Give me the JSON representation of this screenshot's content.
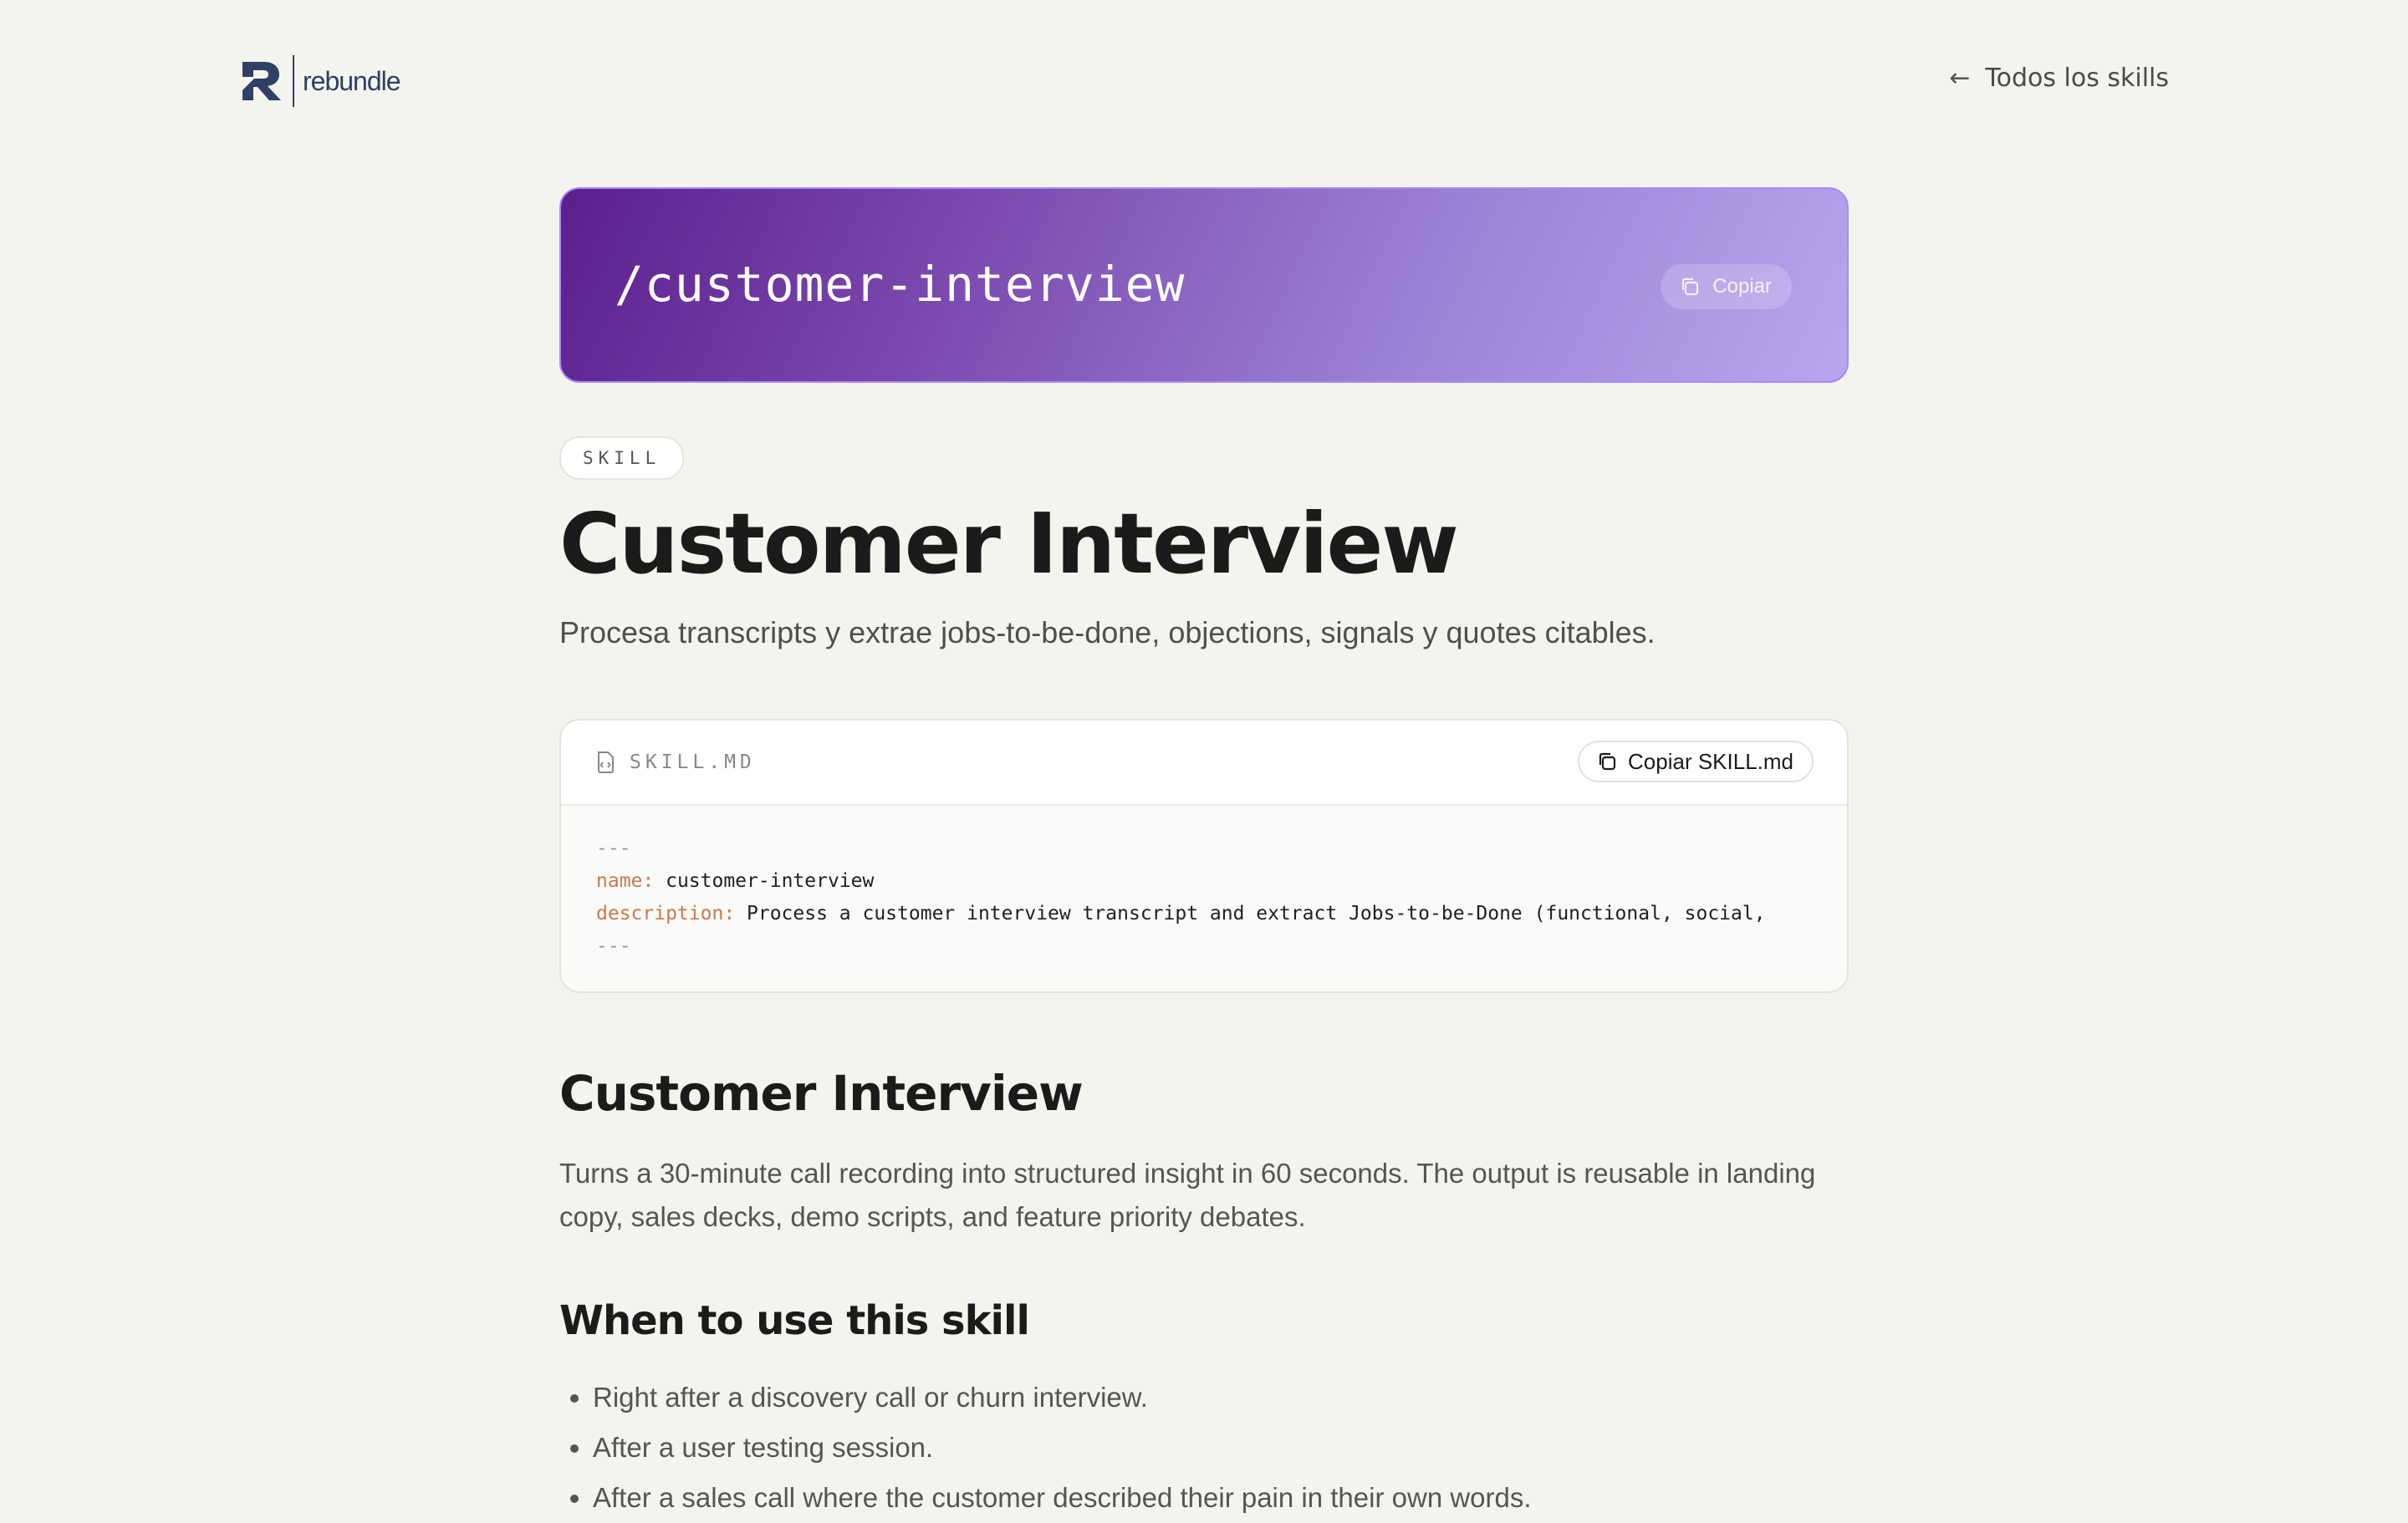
{
  "header": {
    "logo_text": "rebundle",
    "back_link_label": "Todos los skills"
  },
  "hero": {
    "command": "/customer-interview",
    "copy_label": "Copiar"
  },
  "skill": {
    "badge": "SKILL",
    "title": "Customer Interview",
    "subtitle": "Procesa transcripts y extrae jobs-to-be-done, objections, signals y quotes citables."
  },
  "skill_file": {
    "file_name": "SKILL.MD",
    "copy_label": "Copiar SKILL.md",
    "frontmatter_open": "---",
    "name_key": "name:",
    "name_value": " customer-interview",
    "description_key": "description:",
    "description_value": " Process a customer interview transcript and extract Jobs-to-be-Done (functional, social,",
    "frontmatter_close": "---"
  },
  "content": {
    "heading": "Customer Interview",
    "intro": "Turns a 30-minute call recording into structured insight in 60 seconds. The output is reusable in landing copy, sales decks, demo scripts, and feature priority debates.",
    "when_heading": "When to use this skill",
    "when_items": [
      "Right after a discovery call or churn interview.",
      "After a user testing session.",
      "After a sales call where the customer described their pain in their own words."
    ]
  },
  "colors": {
    "background": "#f4f4ef",
    "brand": "#2f4066",
    "hero_gradient_start": "#5b1f8c",
    "hero_gradient_end": "#b9a6ee",
    "code_key": "#c87a4d"
  }
}
